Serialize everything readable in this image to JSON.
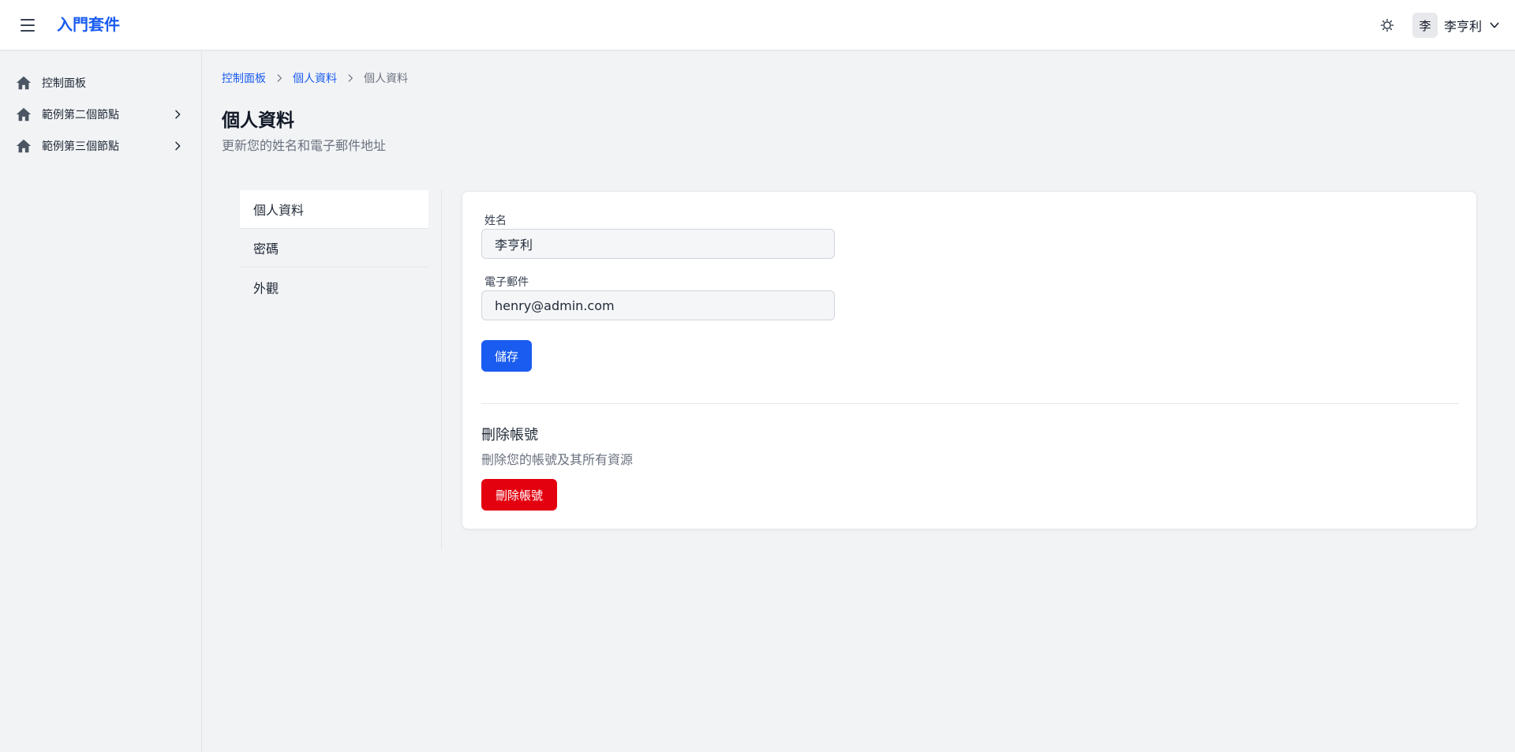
{
  "header": {
    "brand": "入門套件",
    "menu_icon": "hamburger-menu-icon",
    "theme_icon": "sun-icon",
    "user": {
      "avatar_initial": "李",
      "name": "李亨利",
      "dropdown_icon": "chevron-down-icon"
    }
  },
  "sidebar": {
    "items": [
      {
        "label": "控制面板",
        "icon": "home-icon",
        "has_children": false
      },
      {
        "label": "範例第二個節點",
        "icon": "home-icon",
        "has_children": true
      },
      {
        "label": "範例第三個節點",
        "icon": "home-icon",
        "has_children": true
      }
    ]
  },
  "breadcrumb": {
    "items": [
      {
        "label": "控制面板",
        "link": true
      },
      {
        "label": "個人資料",
        "link": true
      },
      {
        "label": "個人資料",
        "link": false
      }
    ]
  },
  "page": {
    "title": "個人資料",
    "subtitle": "更新您的姓名和電子郵件地址"
  },
  "settings_nav": {
    "items": [
      {
        "label": "個人資料",
        "active": true
      },
      {
        "label": "密碼",
        "active": false
      },
      {
        "label": "外觀",
        "active": false
      }
    ]
  },
  "profile_form": {
    "name_label": "姓名",
    "name_value": "李亨利",
    "email_label": "電子郵件",
    "email_value": "henry@admin.com",
    "save_label": "儲存"
  },
  "delete_account": {
    "title": "刪除帳號",
    "description": "刪除您的帳號及其所有資源",
    "button_label": "刪除帳號"
  },
  "colors": {
    "accent": "#1a5cf0",
    "danger": "#e3000f",
    "background": "#f2f3f5"
  }
}
